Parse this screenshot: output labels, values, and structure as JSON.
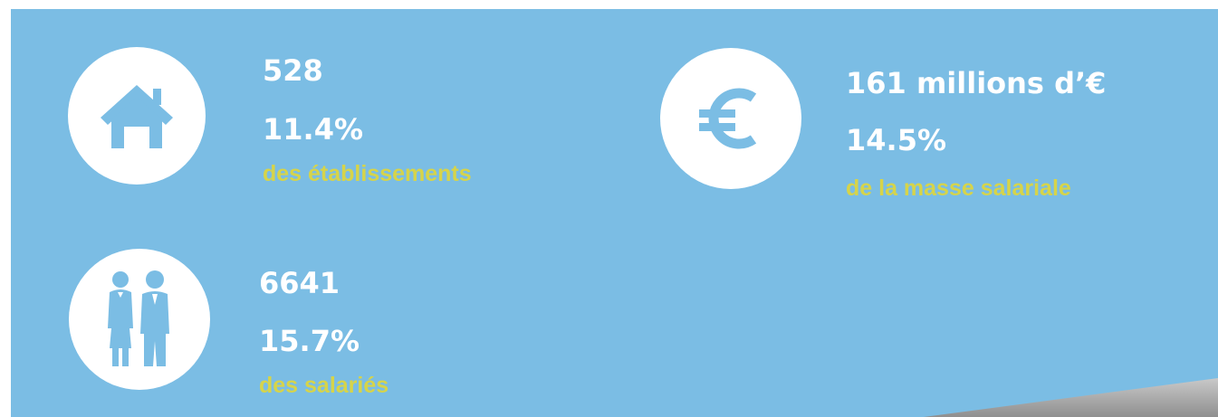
{
  "colors": {
    "background": "#7bbde4",
    "circle": "#ffffff",
    "icon": "#7bbde4",
    "value_text": "#ffffff",
    "caption_text": "#d6d44a"
  },
  "establishments": {
    "icon": "house-icon",
    "count": "528",
    "percent": "11.4%",
    "caption": "des établissements"
  },
  "payroll": {
    "icon": "euro-icon",
    "amount": "161 millions d’€",
    "percent": "14.5%",
    "caption": "de la masse salariale"
  },
  "employees": {
    "icon": "people-icon",
    "count": "6641",
    "percent": "15.7%",
    "caption": "des salariés"
  }
}
